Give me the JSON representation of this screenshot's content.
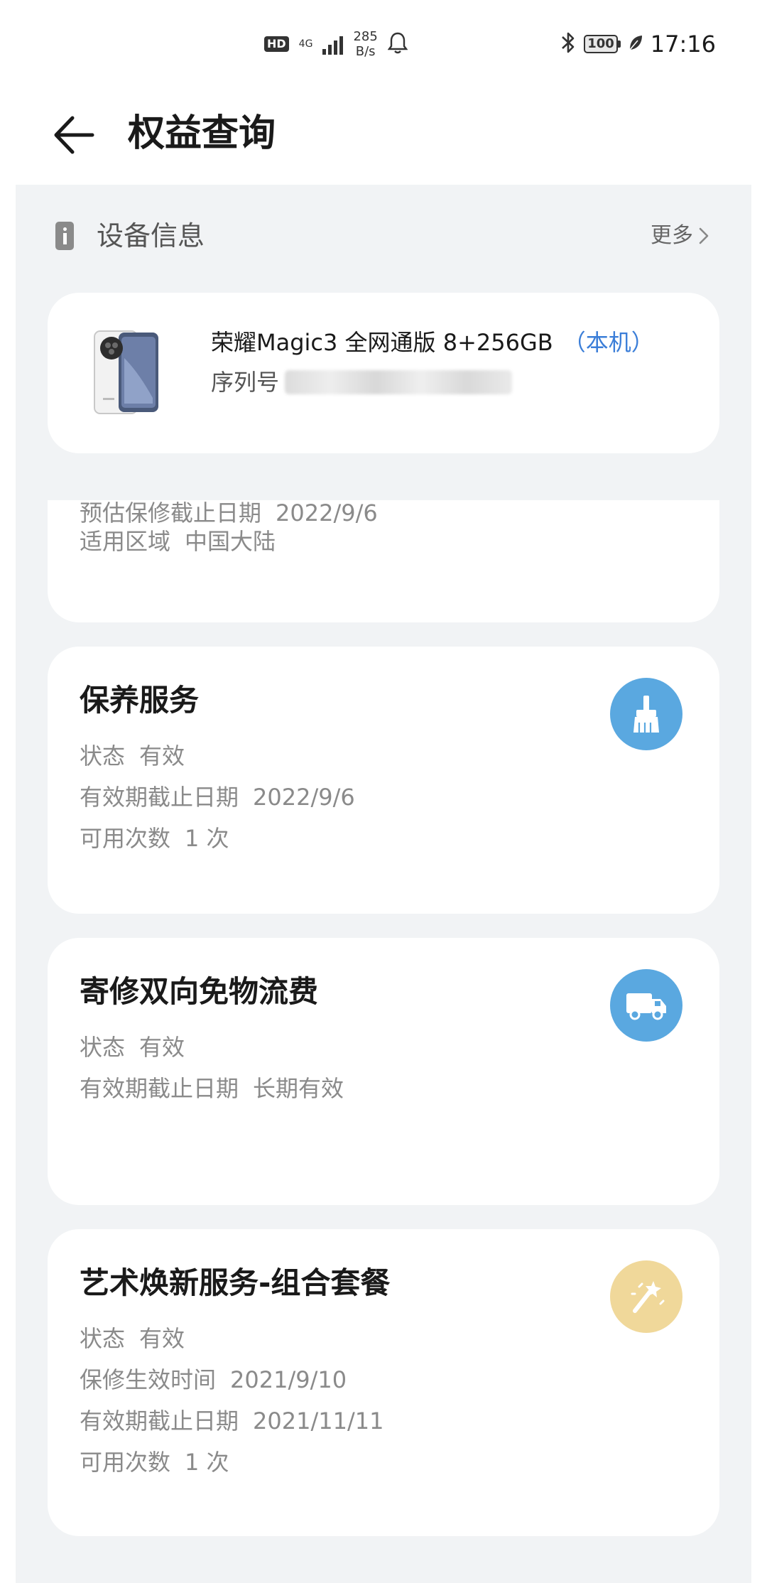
{
  "status_bar": {
    "hd": "HD",
    "network": "4G",
    "speed_value": "285",
    "speed_unit": "B/s",
    "battery": "100",
    "time": "17:16"
  },
  "header": {
    "title": "权益查询"
  },
  "device_section": {
    "title": "设备信息",
    "more": "更多"
  },
  "device": {
    "name": "荣耀Magic3 全网通版 8+256GB",
    "tag": "（本机）",
    "serial_label": "序列号"
  },
  "warranty": {
    "rows": [
      {
        "label": "预估保修截止日期",
        "value": "2022/9/6"
      },
      {
        "label": "适用区域",
        "value": "中国大陆"
      }
    ]
  },
  "services": [
    {
      "title": "保养服务",
      "icon": "brush-icon",
      "icon_color": "#5aa8e0",
      "rows": [
        {
          "label": "状态",
          "value": "有效"
        },
        {
          "label": "有效期截止日期",
          "value": "2022/9/6"
        },
        {
          "label": "可用次数",
          "value": "1 次"
        }
      ]
    },
    {
      "title": "寄修双向免物流费",
      "icon": "truck-icon",
      "icon_color": "#5aa8e0",
      "rows": [
        {
          "label": "状态",
          "value": "有效"
        },
        {
          "label": "有效期截止日期",
          "value": "长期有效"
        }
      ]
    },
    {
      "title": "艺术焕新服务-组合套餐",
      "icon": "magic-wand-icon",
      "icon_color": "#f0d89a",
      "rows": [
        {
          "label": "状态",
          "value": "有效"
        },
        {
          "label": "保修生效时间",
          "value": "2021/9/10"
        },
        {
          "label": "有效期截止日期",
          "value": "2021/11/11"
        },
        {
          "label": "可用次数",
          "value": "1 次"
        }
      ]
    }
  ]
}
